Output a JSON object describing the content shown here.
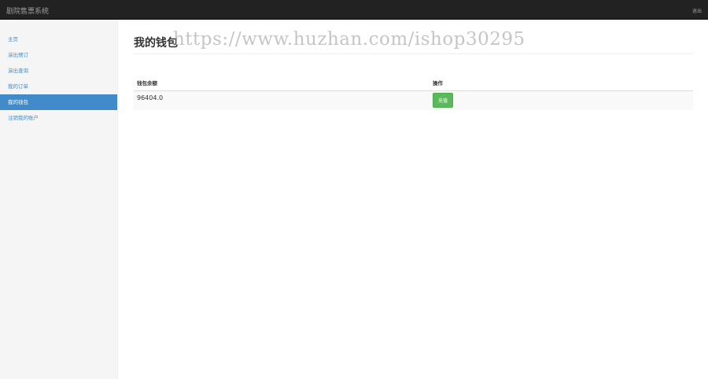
{
  "navbar": {
    "brand": "剧院售票系统",
    "logout": "退出"
  },
  "sidebar": {
    "items": [
      {
        "label": "主页",
        "active": false
      },
      {
        "label": "演出预订",
        "active": false
      },
      {
        "label": "演出查询",
        "active": false
      },
      {
        "label": "我的订单",
        "active": false
      },
      {
        "label": "我的钱包",
        "active": true
      },
      {
        "label": "注销我的账户",
        "active": false
      }
    ]
  },
  "main": {
    "title": "我的钱包",
    "watermark": "https://www.huzhan.com/ishop30295",
    "table": {
      "headers": [
        "钱包余额",
        "操作"
      ],
      "rows": [
        {
          "balance": "96404.0",
          "action_label": "充值"
        }
      ]
    }
  },
  "colors": {
    "navbar_bg": "#222222",
    "sidebar_bg": "#f5f5f5",
    "active_item": "#428bca",
    "button_green": "#5cb85c"
  }
}
